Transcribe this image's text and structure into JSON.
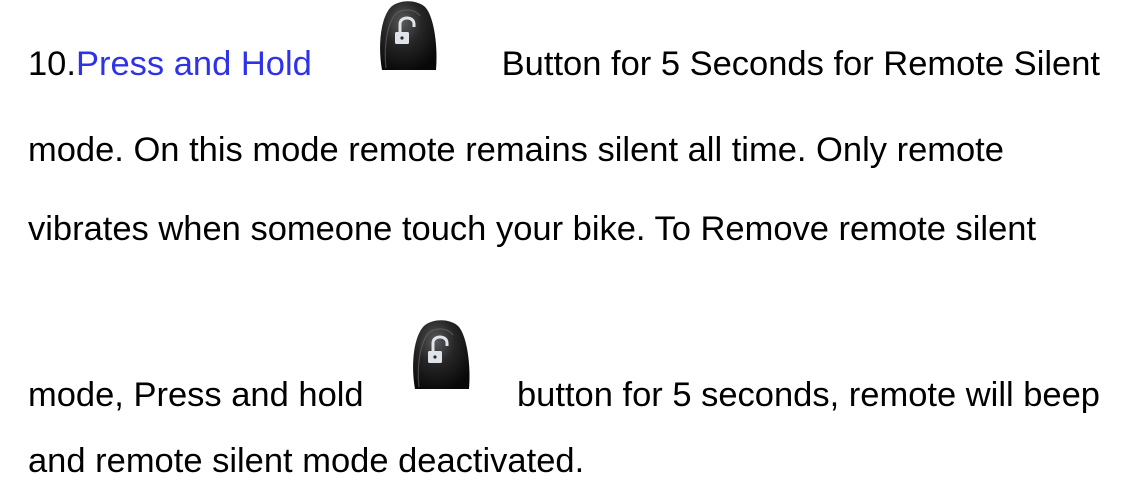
{
  "lines": {
    "l1_a": "10.",
    "l1_link": "Press and Hold",
    "l1_b": "Button for 5 Seconds for Remote Silent",
    "l2": "mode. On this mode remote remains silent all time. Only remote",
    "l3": "vibrates when someone touch your bike. To Remove remote silent",
    "l4_a": "mode, Press and hold",
    "l4_b": "button for 5 seconds, remote will beep",
    "l5": "and remote silent mode deactivated."
  },
  "icons": {
    "remote_button": "unlock-remote-button-icon"
  },
  "colors": {
    "text": "#000000",
    "link": "#2f33e8",
    "button_body": "#1a1a1a"
  }
}
